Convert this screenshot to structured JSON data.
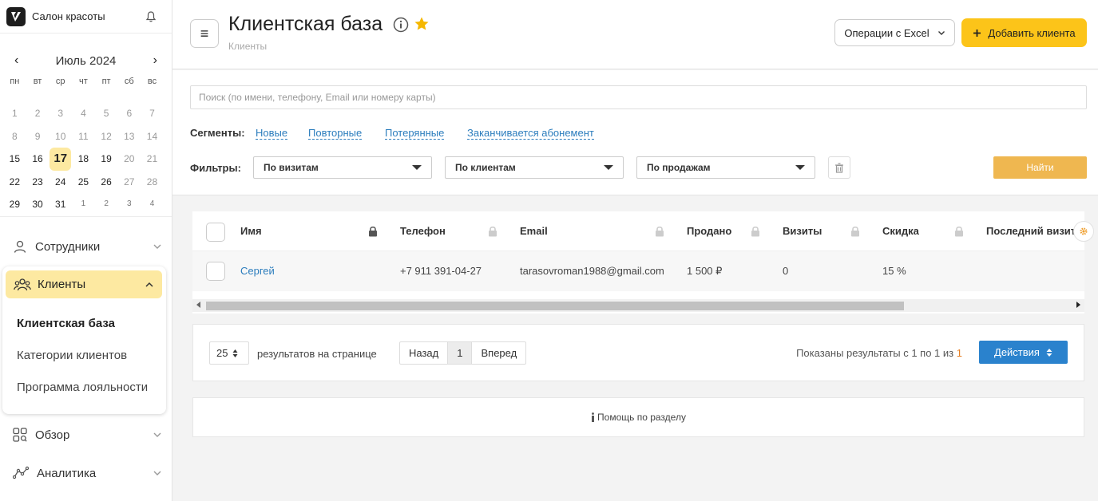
{
  "brand": {
    "name": "Салон красоты"
  },
  "calendar": {
    "month": "Июль 2024",
    "weekdays": [
      "пн",
      "вт",
      "ср",
      "чт",
      "пт",
      "сб",
      "вс"
    ],
    "days": [
      {
        "d": "1",
        "s": "past"
      },
      {
        "d": "2",
        "s": "past"
      },
      {
        "d": "3",
        "s": "past"
      },
      {
        "d": "4",
        "s": "past"
      },
      {
        "d": "5",
        "s": "past"
      },
      {
        "d": "6",
        "s": "past"
      },
      {
        "d": "7",
        "s": "past"
      },
      {
        "d": "8",
        "s": "past"
      },
      {
        "d": "9",
        "s": "past"
      },
      {
        "d": "10",
        "s": "past"
      },
      {
        "d": "11",
        "s": "past"
      },
      {
        "d": "12",
        "s": "past"
      },
      {
        "d": "13",
        "s": "past"
      },
      {
        "d": "14",
        "s": "past"
      },
      {
        "d": "15",
        "s": ""
      },
      {
        "d": "16",
        "s": ""
      },
      {
        "d": "17",
        "s": "today"
      },
      {
        "d": "18",
        "s": ""
      },
      {
        "d": "19",
        "s": ""
      },
      {
        "d": "20",
        "s": "past"
      },
      {
        "d": "21",
        "s": "past"
      },
      {
        "d": "22",
        "s": ""
      },
      {
        "d": "23",
        "s": ""
      },
      {
        "d": "24",
        "s": ""
      },
      {
        "d": "25",
        "s": ""
      },
      {
        "d": "26",
        "s": ""
      },
      {
        "d": "27",
        "s": "past"
      },
      {
        "d": "28",
        "s": "past"
      },
      {
        "d": "29",
        "s": ""
      },
      {
        "d": "30",
        "s": ""
      },
      {
        "d": "31",
        "s": ""
      },
      {
        "d": "1",
        "s": "other"
      },
      {
        "d": "2",
        "s": "other"
      },
      {
        "d": "3",
        "s": "other past"
      },
      {
        "d": "4",
        "s": "other past"
      }
    ]
  },
  "nav": {
    "staff": "Сотрудники",
    "clients": "Клиенты",
    "clients_sub": [
      "Клиентская база",
      "Категории клиентов",
      "Программа лояльности"
    ],
    "overview": "Обзор",
    "analytics": "Аналитика"
  },
  "header": {
    "title": "Клиентская база",
    "breadcrumb": "Клиенты",
    "excel_label": "Операции с Excel",
    "add_label": "Добавить клиента",
    "menu_glyph": "≡"
  },
  "search": {
    "placeholder": "Поиск (по имени, телефону, Email или номеру карты)"
  },
  "segments": {
    "label": "Сегменты:",
    "items": [
      "Новые",
      "Повторные",
      "Потерянные",
      "Заканчивается абонемент"
    ]
  },
  "filters": {
    "label": "Фильтры:",
    "selects": [
      "По визитам",
      "По клиентам",
      "По продажам"
    ],
    "find_label": "Найти"
  },
  "table": {
    "headers": [
      "Имя",
      "Телефон",
      "Email",
      "Продано",
      "Визиты",
      "Скидка",
      "Последний визит"
    ],
    "rows": [
      {
        "name": "Сергей",
        "phone": "+7 911 391-04-27",
        "email": "tarasovroman1988@gmail.com",
        "sold": "1 500 ₽",
        "visits": "0",
        "discount": "15 %"
      }
    ]
  },
  "pagination": {
    "per_page": "25",
    "per_page_label": "результатов на странице",
    "prev": "Назад",
    "current": "1",
    "next": "Вперед",
    "shown_text": "Показаны результаты с 1 по 1 из",
    "total": "1",
    "actions_label": "Действия"
  },
  "help": {
    "label": "Помощь по разделу"
  },
  "colors": {
    "accent": "#fcc419",
    "link": "#2c7dbd",
    "primary": "#2a82cd",
    "find": "#efb750",
    "highlight": "#fde9a1"
  }
}
